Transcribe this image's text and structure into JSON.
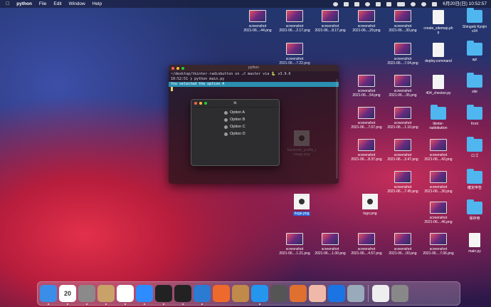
{
  "menubar": {
    "app_name": "python",
    "menus": [
      "File",
      "Edit",
      "Window",
      "Help"
    ],
    "clock": "6月20日(日) 10:52:57"
  },
  "desktop_icons": [
    {
      "label1": "screenshot",
      "label2": "2021-06....44.png",
      "kind": "thumb"
    },
    {
      "label1": "screenshot",
      "label2": "2021-06....2.17.png",
      "kind": "thumb"
    },
    {
      "label1": "screenshot",
      "label2": "2021-06....8.17.png",
      "kind": "thumb"
    },
    {
      "label1": "screenshot",
      "label2": "2021-06....29.png",
      "kind": "thumb"
    },
    {
      "label1": "screenshot",
      "label2": "2021-06....30.png",
      "kind": "thumb"
    },
    {
      "label1": "create_sitemap.ph",
      "label2": "p",
      "kind": "doc",
      "badge": "PHP"
    },
    {
      "label1": "Shingeki Kyojin",
      "label2": "v34",
      "kind": "folder"
    },
    {
      "label1": "screenshot",
      "label2": "2021-06....7.22.png",
      "kind": "thumb"
    },
    {
      "label1": "screenshot",
      "label2": "2021-06....7.04.png",
      "kind": "thumb"
    },
    {
      "label1": "deploy.command",
      "label2": "",
      "kind": "doc",
      "badge": "SHELL"
    },
    {
      "label1": "api",
      "label2": "",
      "kind": "folder"
    },
    {
      "label1": "screenshot",
      "label2": "2021-06....54.png",
      "kind": "thumb"
    },
    {
      "label1": "screenshot",
      "label2": "2021-06....35.png",
      "kind": "thumb"
    },
    {
      "label1": "404_checker.py",
      "label2": "",
      "kind": "doc",
      "badge": "PYTHON"
    },
    {
      "label1": "site",
      "label2": "",
      "kind": "folder"
    },
    {
      "label1": "screenshot",
      "label2": "2021-06....7.07.png",
      "kind": "thumb"
    },
    {
      "label1": "screenshot",
      "label2": "2021-06....1.10.png",
      "kind": "thumb"
    },
    {
      "label1": "tkinter-",
      "label2": "radiobutton",
      "kind": "folder"
    },
    {
      "label1": "front",
      "label2": "",
      "kind": "folder"
    },
    {
      "label1": "screenshot",
      "label2": "2021-06....8.37.png",
      "kind": "thumb"
    },
    {
      "label1": "screenshot",
      "label2": "2021-06....3.47.png",
      "kind": "thumb"
    },
    {
      "label1": "screenshot",
      "label2": "2021-06....43.png",
      "kind": "thumb"
    },
    {
      "label1": "ロゴ",
      "label2": "",
      "kind": "folder"
    },
    {
      "label1": "screenshot",
      "label2": "2021-06....7.45.png",
      "kind": "thumb"
    },
    {
      "label1": "screenshot",
      "label2": "2021-06....30.png",
      "kind": "thumb"
    },
    {
      "label1": "確定申告",
      "label2": "",
      "kind": "folder"
    },
    {
      "label1": "screenshot",
      "label2": "2021-06....46.png",
      "kind": "thumb"
    },
    {
      "label1": "保存用",
      "label2": "",
      "kind": "folder"
    },
    {
      "label1": "hoge.png",
      "label2": "",
      "kind": "logo"
    },
    {
      "label1": "logo.png",
      "label2": "",
      "kind": "logo"
    },
    {
      "label1": "main.py",
      "label2": "",
      "kind": "doc",
      "badge": "PYTHON"
    },
    {
      "label1": "screenshot",
      "label2": "2021-06....1.21.png",
      "kind": "thumb"
    },
    {
      "label1": "screenshot",
      "label2": "2021-06....1.00.png",
      "kind": "thumb"
    },
    {
      "label1": "screenshot",
      "label2": "2021-06....4.57.png",
      "kind": "thumb"
    },
    {
      "label1": "screenshot",
      "label2": "2021-06....00.png",
      "kind": "thumb"
    },
    {
      "label1": "screenshot",
      "label2": "2021-06....7.06.png",
      "kind": "thumb"
    },
    {
      "label1": "facebook_profile_i",
      "label2": "mage.png",
      "kind": "logo"
    }
  ],
  "terminal": {
    "title": "python",
    "prompt_line": "~/desktop/tkinter-radiobutton on ⎇ master via 🐍 v3.9.6",
    "time": "10:52:51",
    "command": "❯ python main.py",
    "output": "You selected the option A"
  },
  "tk_window": {
    "title": "tk",
    "options": [
      "Option A",
      "Option B",
      "Option C",
      "Option D"
    ]
  },
  "dock": {
    "apps": [
      "finder",
      "calendar",
      "system-preferences",
      "contacts",
      "chrome",
      "zoom",
      "activity-monitor",
      "terminal",
      "vscode",
      "slack-like",
      "archive",
      "docker",
      "quicktime",
      "sourcetree",
      "preview",
      "remote",
      "screenshot",
      "file",
      "trash"
    ],
    "calendar_day": "20"
  }
}
